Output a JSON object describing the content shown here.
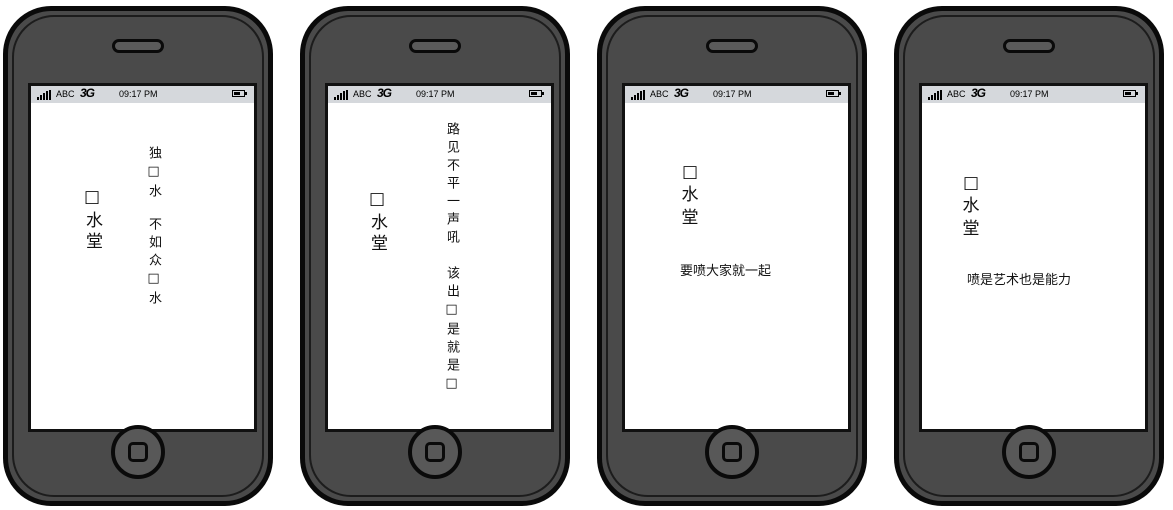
{
  "status_bar": {
    "carrier": "ABC",
    "network": "3G",
    "time": "09:17 PM"
  },
  "screens": [
    {
      "logo": "□水堂",
      "slogan_columns": [
        "独□水",
        "不如众□水"
      ]
    },
    {
      "logo": "□水堂",
      "slogan_columns": [
        "路见不平一声吼",
        "该出□是就是□"
      ]
    },
    {
      "logo_chars": [
        "□",
        "水",
        "堂"
      ],
      "slogan": "要喷大家就一起"
    },
    {
      "logo_chars": [
        "□",
        "水",
        "堂"
      ],
      "slogan": "喷是艺术也是能力"
    }
  ]
}
